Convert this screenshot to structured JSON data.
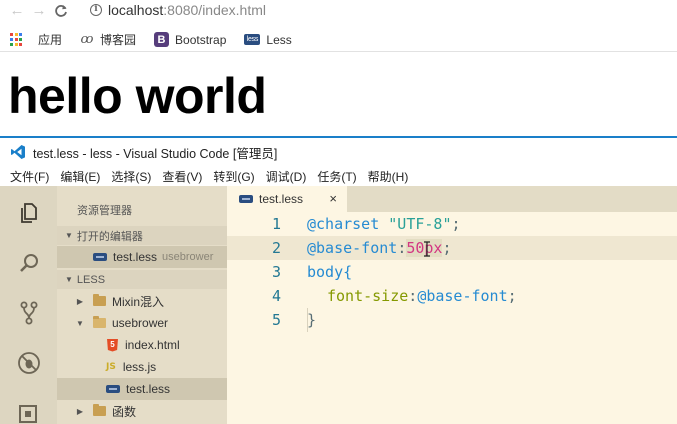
{
  "browser": {
    "url_host": "localhost",
    "url_rest": ":8080/index.html",
    "bookmarks": [
      {
        "label": "应用",
        "icon": "apps-grid-icon"
      },
      {
        "label": "博客园",
        "icon": "cnblogs-icon"
      },
      {
        "label": "Bootstrap",
        "icon": "bootstrap-icon"
      },
      {
        "label": "Less",
        "icon": "less-icon"
      }
    ]
  },
  "page": {
    "heading": "hello world"
  },
  "vscode": {
    "title": "test.less - less - Visual Studio Code [管理员]",
    "menu": [
      "文件(F)",
      "编辑(E)",
      "选择(S)",
      "查看(V)",
      "转到(G)",
      "调试(D)",
      "任务(T)",
      "帮助(H)"
    ],
    "sidebar": {
      "title": "资源管理器",
      "open_editors_label": "打开的编辑器",
      "open_editor": {
        "name": "test.less",
        "folder": "usebrower"
      },
      "project_label": "LESS",
      "tree": [
        {
          "label": "Mixin混入",
          "type": "folder",
          "expanded": false
        },
        {
          "label": "usebrower",
          "type": "folder",
          "expanded": true
        },
        {
          "label": "index.html",
          "type": "html"
        },
        {
          "label": "less.js",
          "type": "js"
        },
        {
          "label": "test.less",
          "type": "less",
          "selected": true
        },
        {
          "label": "函数",
          "type": "folder",
          "expanded": false
        }
      ]
    },
    "tab": {
      "label": "test.less",
      "close": "×"
    },
    "code": {
      "line_numbers": [
        "1",
        "2",
        "3",
        "4",
        "5"
      ],
      "l1_at": "@charset",
      "l1_str": "\"UTF-8\"",
      "l1_end": ";",
      "l2_var": "@base-font",
      "l2_colon": ":",
      "l2_num": "50",
      "l2_unit": "px",
      "l2_end": ";",
      "l3": "body{",
      "l4_prop": "font-size",
      "l4_colon": ":",
      "l4_var": "@base-font",
      "l4_end": ";",
      "l5": "}"
    },
    "colors": {
      "activity_bar": "#ddd6c1",
      "sidebar": "#e5ddc8",
      "editor_bg": "#fdf6e3",
      "line_number": "#237893",
      "accent": "#1a7fc9"
    }
  }
}
